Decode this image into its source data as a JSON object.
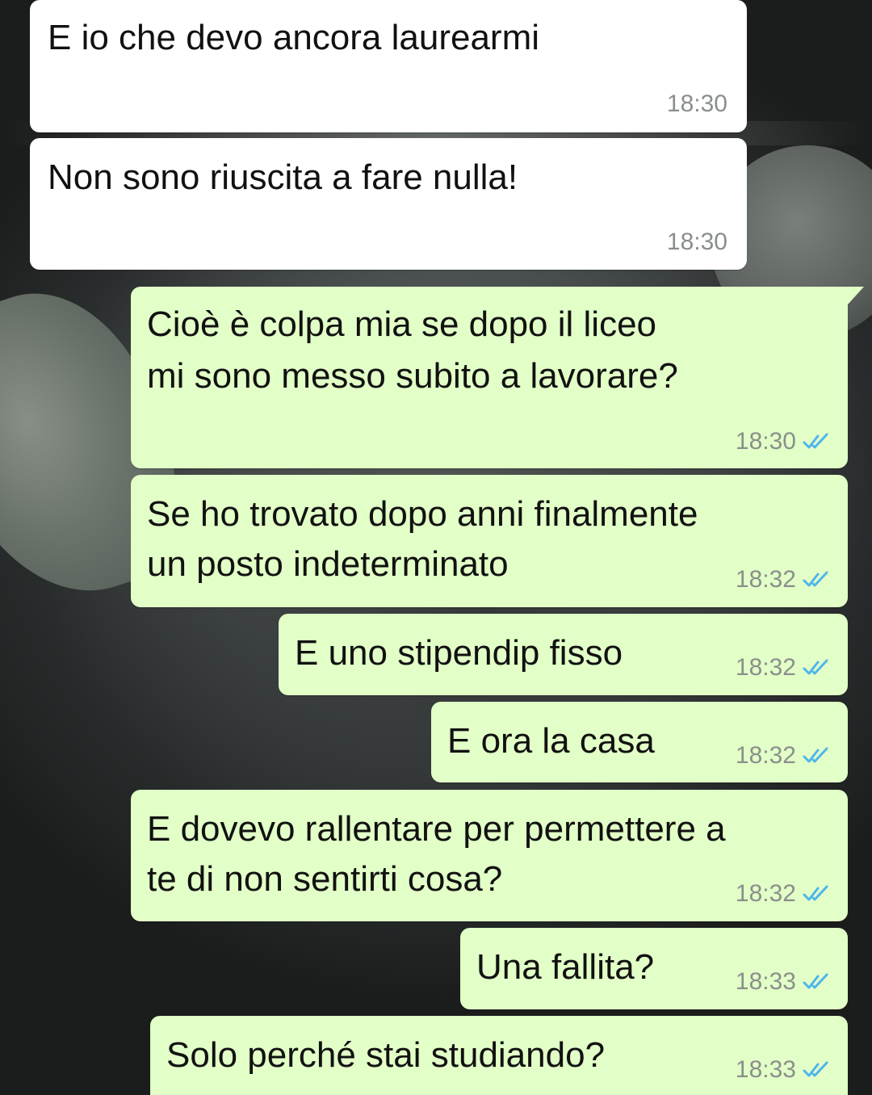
{
  "conversation": {
    "messages": [
      {
        "direction": "in",
        "text": "E io che devo ancora laurearmi",
        "time": "18:30"
      },
      {
        "direction": "in",
        "text": "Non sono riuscita a fare nulla!",
        "time": "18:30"
      },
      {
        "direction": "out",
        "text_line1": "Cioè è colpa mia se dopo il liceo",
        "text_line2": "mi sono messo subito a lavorare?",
        "time": "18:30",
        "status_icon": "double-check-read"
      },
      {
        "direction": "out",
        "text_line1": "Se ho trovato dopo anni finalmente",
        "text_line2": "un posto indeterminato",
        "time": "18:32",
        "status_icon": "double-check-read"
      },
      {
        "direction": "out",
        "text": "E uno stipendip fisso",
        "time": "18:32",
        "status_icon": "double-check-read"
      },
      {
        "direction": "out",
        "text": "E ora la casa",
        "time": "18:32",
        "status_icon": "double-check-read"
      },
      {
        "direction": "out",
        "text_line1": "E dovevo rallentare per permettere a",
        "text_line2": "te di non sentirti cosa?",
        "time": "18:32",
        "status_icon": "double-check-read"
      },
      {
        "direction": "out",
        "text": "Una fallita?",
        "time": "18:33",
        "status_icon": "double-check-read"
      },
      {
        "direction": "out",
        "text": "Solo perché stai studiando?",
        "time": "18:33",
        "status_icon": "double-check-read"
      }
    ]
  },
  "colors": {
    "incoming_bubble": "#ffffff",
    "outgoing_bubble": "#e2ffc7",
    "read_check": "#4fb6ec",
    "timestamp": "#8a8f8b"
  }
}
